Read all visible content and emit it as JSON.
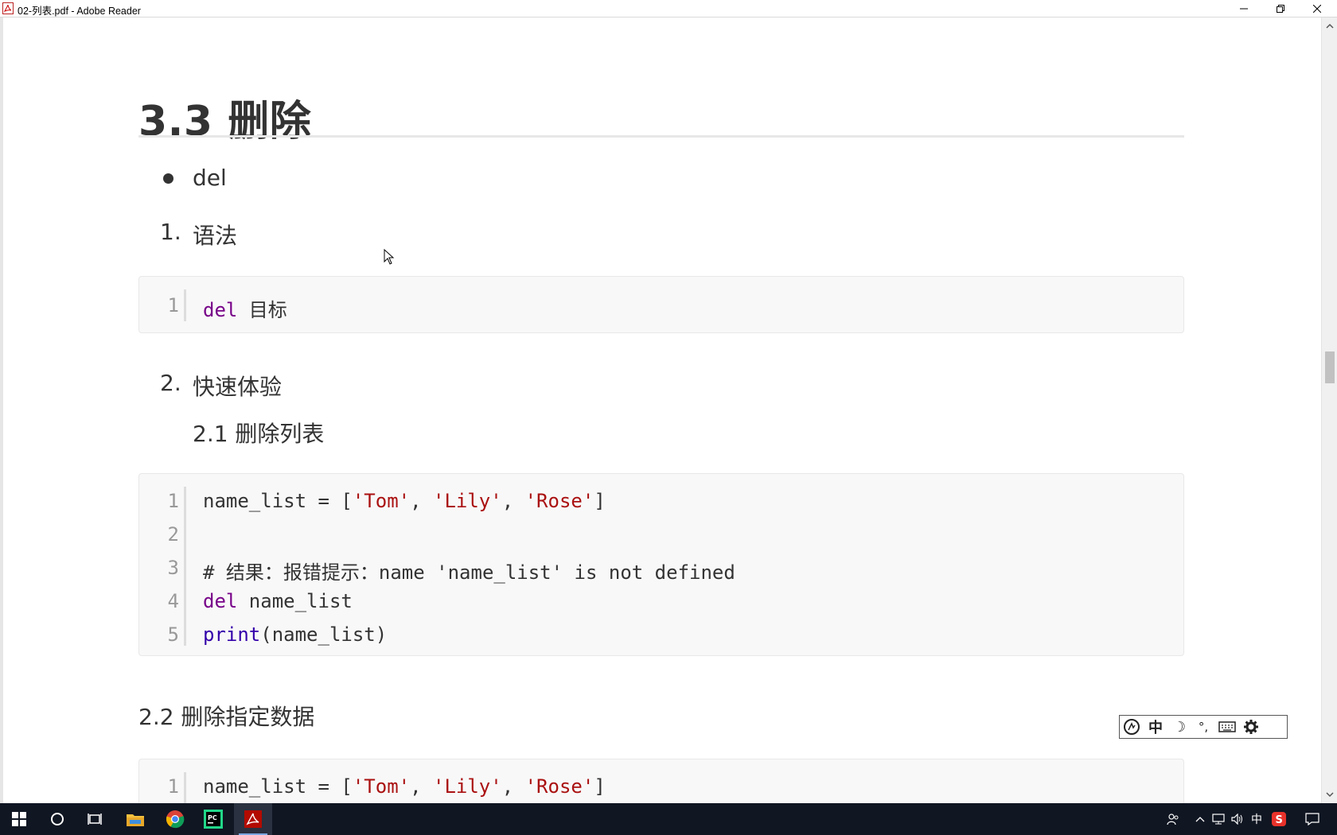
{
  "window": {
    "title": "02-列表.pdf - Adobe Reader"
  },
  "document": {
    "heading": "3.3 删除",
    "bullet_del": "del",
    "item1_num": "1.",
    "item1_text": "语法",
    "code1": {
      "lines": [
        {
          "n": "1",
          "kw": "del",
          "rest": " 目标"
        }
      ]
    },
    "item2_num": "2.",
    "item2_text": "快速体验",
    "sub21": "2.1 删除列表",
    "code2": {
      "line1": {
        "n": "1",
        "a": "name_list = [",
        "s1": "'Tom'",
        "c1": ", ",
        "s2": "'Lily'",
        "c2": ", ",
        "s3": "'Rose'",
        "b": "]"
      },
      "line2": {
        "n": "2"
      },
      "line3": {
        "n": "3",
        "comment": "# 结果：报错提示：name 'name_list' is not defined"
      },
      "line4": {
        "n": "4",
        "kw": "del",
        "rest": " name_list"
      },
      "line5": {
        "n": "5",
        "fn": "print",
        "rest": "(name_list)"
      }
    },
    "sub22": "2.2 删除指定数据",
    "code3": {
      "line1": {
        "n": "1",
        "a": "name_list = [",
        "s1": "'Tom'",
        "c1": ", ",
        "s2": "'Lily'",
        "c2": ", ",
        "s3": "'Rose'",
        "b": "]"
      }
    }
  },
  "ime_toolbar": {
    "lang": "中",
    "mode": "☽",
    "punct": "°,"
  },
  "taskbar": {
    "tray_ime": "中"
  }
}
